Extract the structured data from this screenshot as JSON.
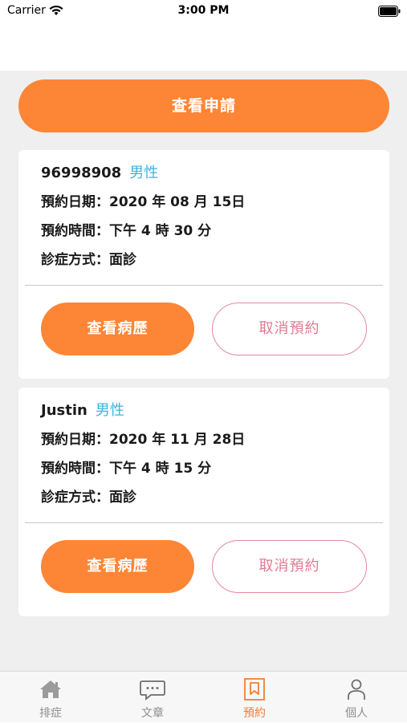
{
  "status_bar": {
    "carrier": "Carrier",
    "time": "3:00 PM"
  },
  "main": {
    "view_applications_label": "查看申請",
    "appointments": [
      {
        "name": "96998908",
        "gender": "男性",
        "date_label": "預約日期：",
        "date_value": "2020 年 08 月 15日",
        "time_label": "預約時間：",
        "time_value": "下午 4 時 30 分",
        "method_label": "診症方式：",
        "method_value": "面診",
        "history_label": "查看病歷",
        "cancel_label": "取消預約"
      },
      {
        "name": "Justin",
        "gender": "男性",
        "date_label": "預約日期：",
        "date_value": "2020 年 11 月 28日",
        "time_label": "預約時間：",
        "time_value": "下午 4 時 15 分",
        "method_label": "診症方式：",
        "method_value": "面診",
        "history_label": "查看病歷",
        "cancel_label": "取消預約"
      }
    ]
  },
  "tab_bar": {
    "tabs": [
      {
        "label": "排症",
        "icon": "home-icon"
      },
      {
        "label": "文章",
        "icon": "chat-icon"
      },
      {
        "label": "預約",
        "icon": "bookmark-icon",
        "active": true
      },
      {
        "label": "個人",
        "icon": "person-icon"
      }
    ]
  },
  "colors": {
    "accent": "#fd8636",
    "gender": "#3fb2e0",
    "cancel": "#e27a92",
    "background": "#efeff0"
  }
}
